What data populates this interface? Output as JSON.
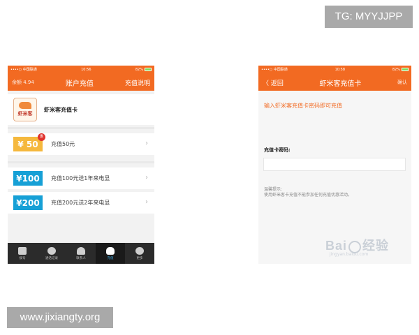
{
  "watermarks": {
    "top_right": "TG: MYYJJPP",
    "bottom_left": "www.jixiangty.org"
  },
  "left_screen": {
    "status": {
      "carrier": "••••○ 中国联通",
      "time": "10:56",
      "battery": "82%"
    },
    "nav": {
      "balance": "余额 4.94",
      "title": "账户充值",
      "action": "充值说明"
    },
    "brand": {
      "logo_text": "虾米客",
      "name": "虾米客充值卡"
    },
    "items": [
      {
        "badge": "¥ 50",
        "hot": "惠",
        "text": "充值50元"
      },
      {
        "badge": "¥100",
        "text": "充值100元送1年来电显"
      },
      {
        "badge": "¥200",
        "text": "充值200元送2年来电显"
      }
    ],
    "tabs": [
      {
        "label": "拨号",
        "icon": "dialpad-icon"
      },
      {
        "label": "通话记录",
        "icon": "call-log-icon"
      },
      {
        "label": "联系人",
        "icon": "contacts-icon"
      },
      {
        "label": "充值",
        "icon": "money-bag-icon"
      },
      {
        "label": "更多",
        "icon": "more-icon"
      }
    ],
    "active_tab": 3,
    "colors": {
      "accent": "#f26a22",
      "gold_badge": "#f5b83d",
      "blue_badge": "#16a0d6",
      "tabbar": "#2b2b2b"
    }
  },
  "right_screen": {
    "status": {
      "carrier": "••••○ 中国联通",
      "time": "10:58",
      "battery": "82%"
    },
    "nav": {
      "back": "〈 返回",
      "title": "虾米客充值卡",
      "action": "确认"
    },
    "tip": "输入虾米客充值卡密码即可充值",
    "password_label": "充值卡密码:",
    "password_value": "",
    "note_title": "温馨提示:",
    "note_body": "使用虾米客卡充值不能参加任何充值优惠活动。",
    "baidu": {
      "text_left": "Bai",
      "text_right": "经验",
      "url": "jingyan.baidu.com"
    }
  }
}
